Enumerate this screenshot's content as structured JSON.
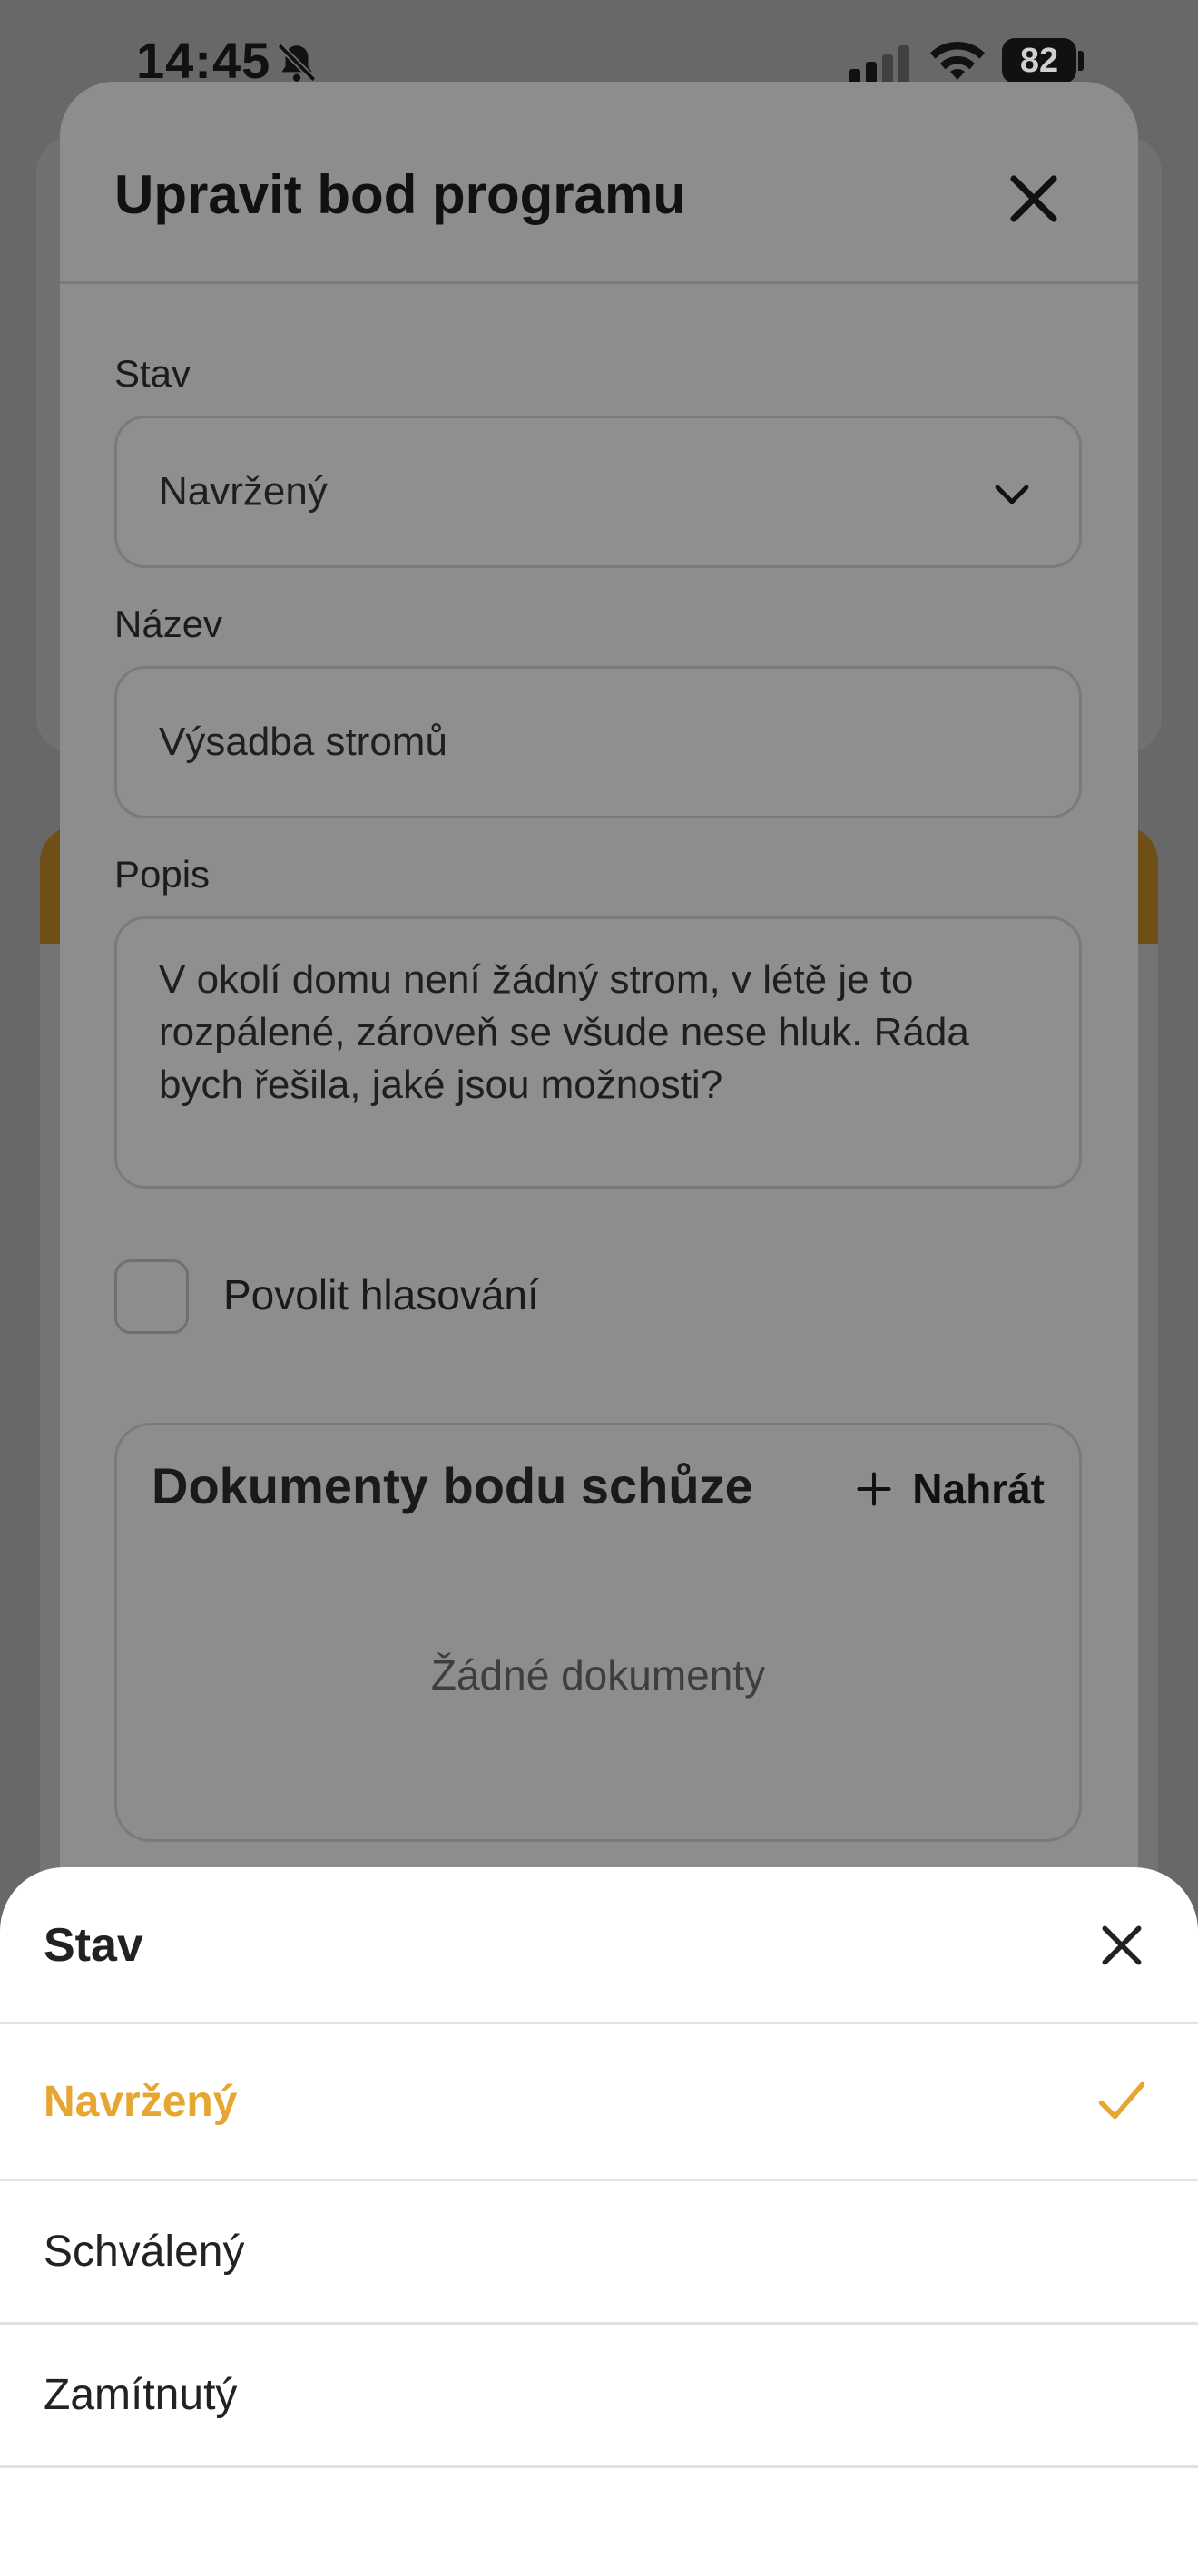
{
  "status_bar": {
    "time": "14:45",
    "battery": "82"
  },
  "modal": {
    "title": "Upravit bod programu",
    "stav": {
      "label": "Stav",
      "value": "Navržený"
    },
    "nazev": {
      "label": "Název",
      "value": "Výsadba stromů"
    },
    "popis": {
      "label": "Popis",
      "value": "V okolí domu není žádný strom, v létě je to rozpálené, zároveň se všude nese hluk. Ráda bych řešila, jaké jsou možnosti?"
    },
    "voting": {
      "label": "Povolit hlasování",
      "checked": false
    },
    "documents": {
      "title": "Dokumenty bodu schůze",
      "upload_label": "Nahrát",
      "empty_text": "Žádné dokumenty"
    }
  },
  "sheet": {
    "title": "Stav",
    "options": [
      {
        "label": "Navržený",
        "selected": true
      },
      {
        "label": "Schválený",
        "selected": false
      },
      {
        "label": "Zamítnutý",
        "selected": false
      }
    ]
  },
  "colors": {
    "accent": "#e7a631"
  },
  "icons": [
    "bell-off-icon",
    "signal-icon",
    "wifi-icon",
    "battery-icon",
    "close-icon",
    "chevron-down-icon",
    "plus-icon",
    "check-icon"
  ]
}
